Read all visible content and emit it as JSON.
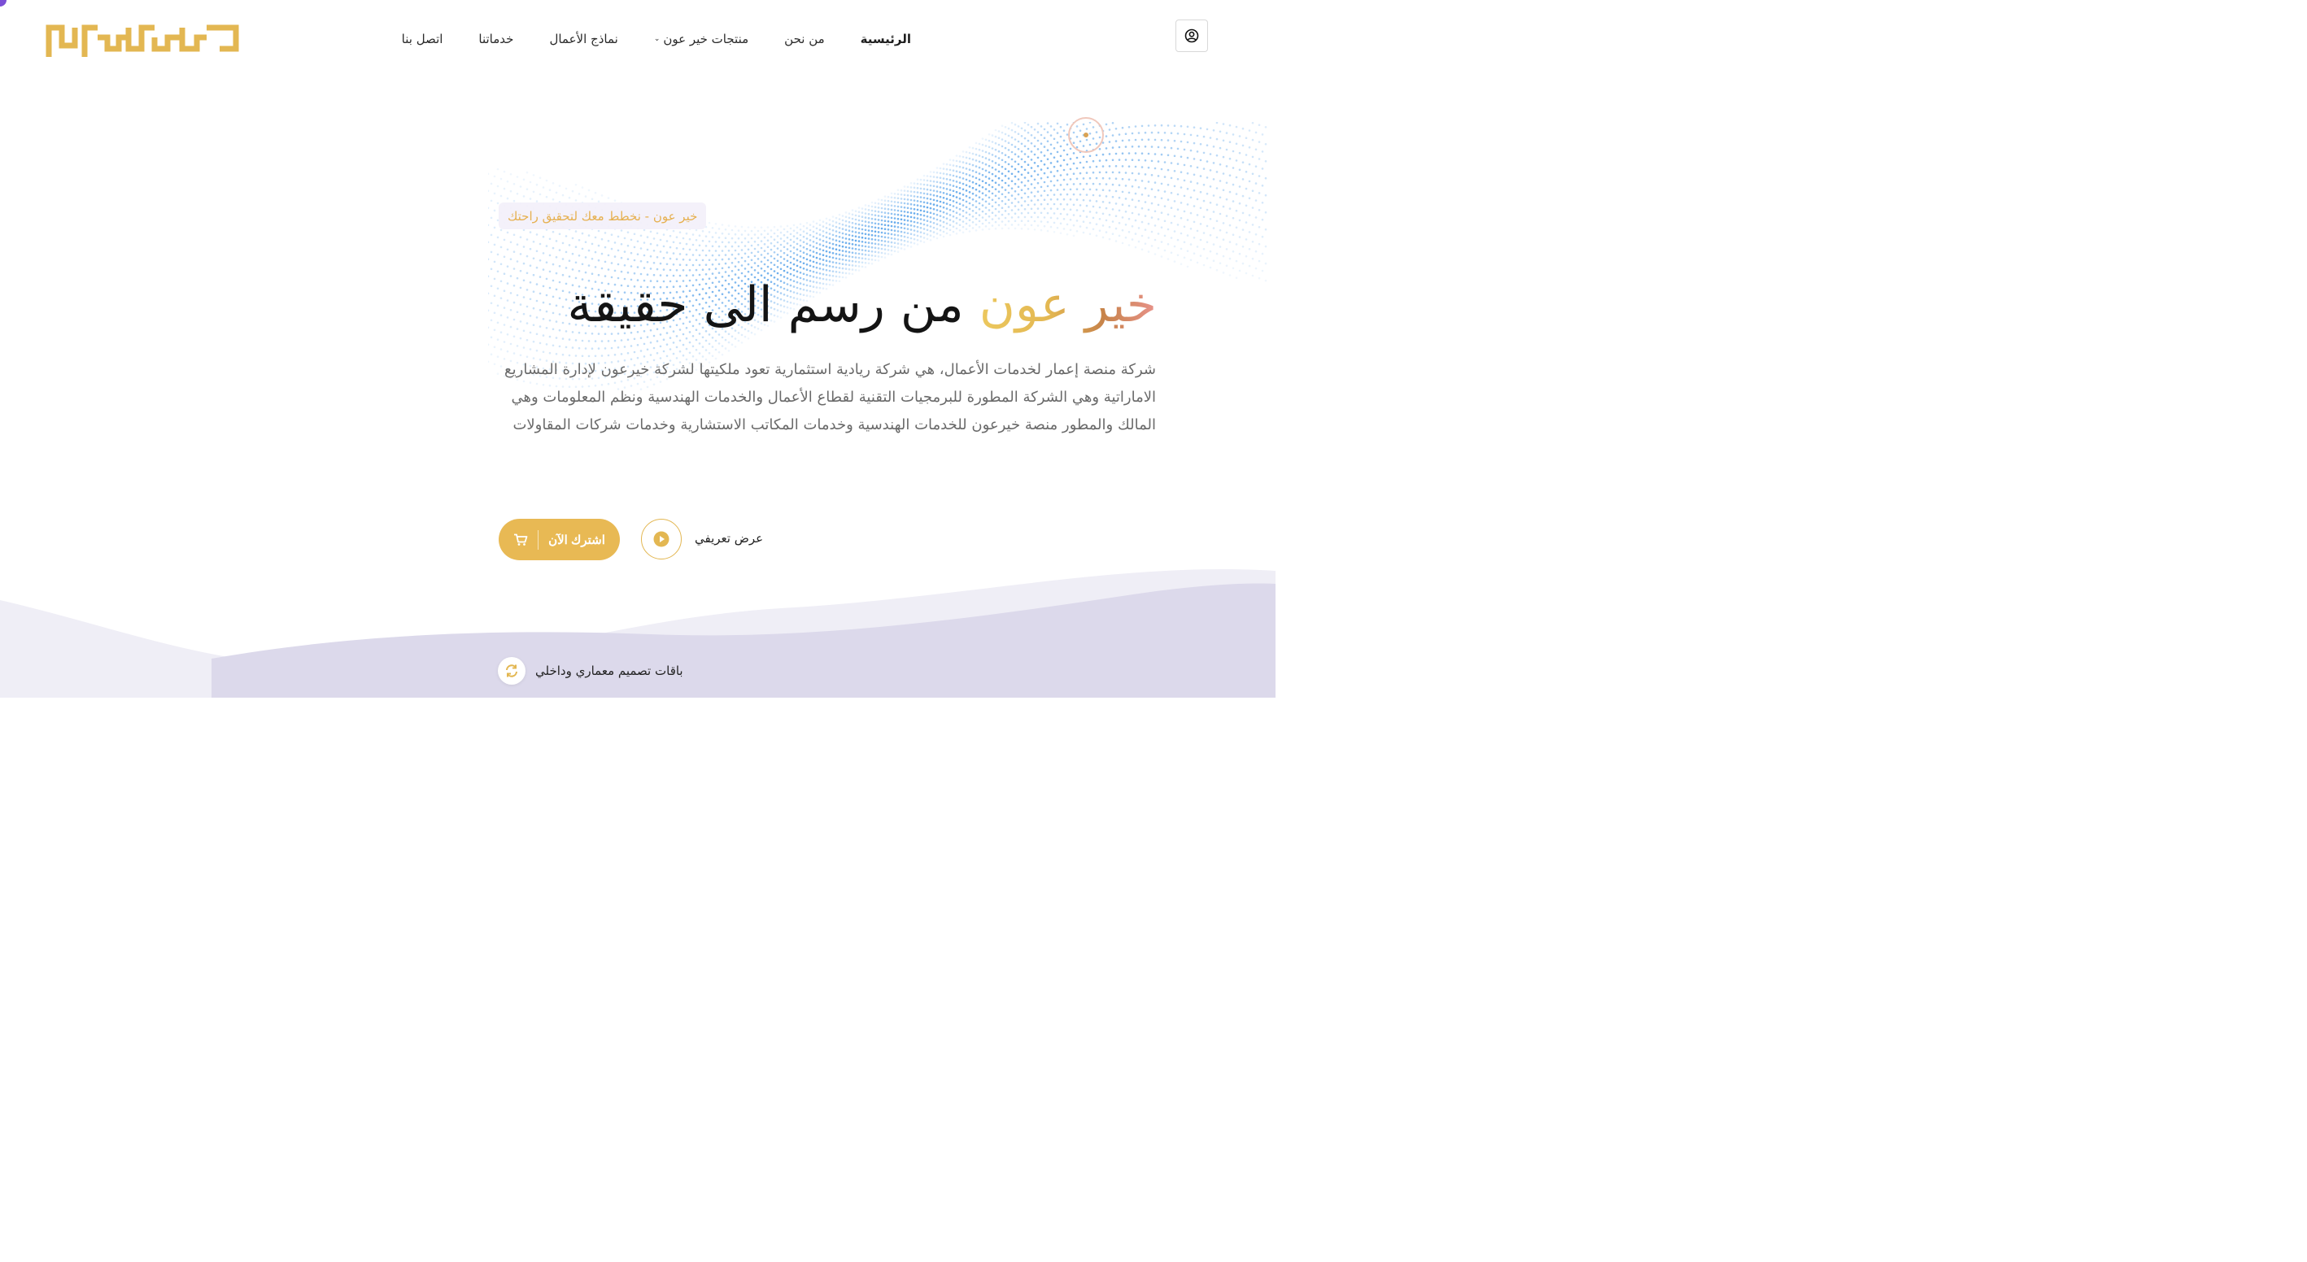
{
  "brand": {
    "logo_text": "خيرعون",
    "logo_color": "#E3B752"
  },
  "nav": {
    "items": [
      {
        "label": "الرئيسية",
        "active": true
      },
      {
        "label": "من نحن"
      },
      {
        "label": "منتجات خير عون",
        "has_dropdown": true
      },
      {
        "label": "نماذج الأعمال"
      },
      {
        "label": "خدماتنا"
      },
      {
        "label": "اتصل بنا"
      }
    ],
    "user_icon": "user-circle-icon"
  },
  "hero": {
    "tagline": "خير عون - نخطط معك لتحقيق راحتك",
    "title_brand": "خير عون",
    "title_rest": " من رسم الى حقيقة",
    "description": "شركة منصة إعمار لخدمات الأعمال، هي شركة ريادية استثمارية تعود ملكيتها لشركة خيرعون لإدارة المشاريع الاماراتية وهي الشركة المطورة للبرمجيات التقنية لقطاع الأعمال والخدمات الهندسية ونظم المعلومات وهي المالك والمطور منصة خيرعون للخدمات الهندسية وخدمات المكاتب الاستشارية وخدمات شركات المقاولات",
    "subscribe_label": "اشترك الآن",
    "subscribe_icon": "cart-icon",
    "video_label": "عرض تعريفي",
    "video_icon": "play-icon"
  },
  "packages": {
    "label": "باقات تصميم معماري وداخلي",
    "icon": "refresh-icon"
  },
  "colors": {
    "accent": "#E8B954",
    "wave_light": "#EFEEF6",
    "wave_dark": "#DCD9EB",
    "dots": "#4A9BE8"
  }
}
